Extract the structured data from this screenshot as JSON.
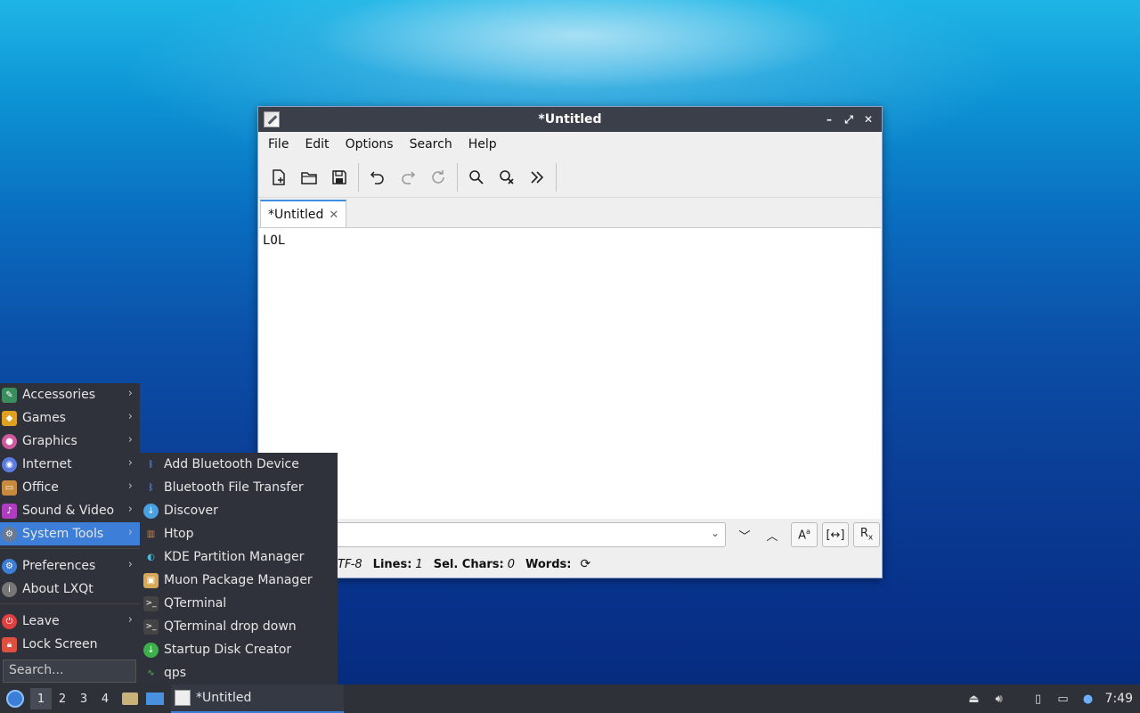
{
  "window": {
    "title": "*Untitled",
    "menus": [
      "File",
      "Edit",
      "Options",
      "Search",
      "Help"
    ],
    "tab_label": "*Untitled",
    "content": "LOL",
    "status": {
      "encoding_value": "TF-8",
      "lines_label": "Lines:",
      "lines_value": "1",
      "sel_label": "Sel. Chars:",
      "sel_value": "0",
      "words_label": "Words:"
    }
  },
  "app_menu": {
    "items": [
      {
        "label": "Accessories",
        "icon": "accessories-icon",
        "color": "#3a8d5c"
      },
      {
        "label": "Games",
        "icon": "games-icon",
        "color": "#e0a020"
      },
      {
        "label": "Graphics",
        "icon": "graphics-icon",
        "color": "#d05aa0"
      },
      {
        "label": "Internet",
        "icon": "internet-icon",
        "color": "#5a7be0"
      },
      {
        "label": "Office",
        "icon": "office-icon",
        "color": "#c88a3c"
      },
      {
        "label": "Sound & Video",
        "icon": "sound-video-icon",
        "color": "#b03cc0"
      },
      {
        "label": "System Tools",
        "icon": "system-tools-icon",
        "color": "#6a7a90"
      }
    ],
    "preferences": "Preferences",
    "about": "About LXQt",
    "leave": "Leave",
    "lock": "Lock Screen",
    "search_placeholder": "Search..."
  },
  "submenu": {
    "items": [
      {
        "label": "Add Bluetooth Device",
        "icon": "bluetooth-icon"
      },
      {
        "label": "Bluetooth File Transfer",
        "icon": "bluetooth-icon"
      },
      {
        "label": "Discover",
        "icon": "discover-icon"
      },
      {
        "label": "Htop",
        "icon": "htop-icon"
      },
      {
        "label": "KDE Partition Manager",
        "icon": "partition-manager-icon"
      },
      {
        "label": "Muon Package Manager",
        "icon": "muon-icon"
      },
      {
        "label": "QTerminal",
        "icon": "terminal-icon"
      },
      {
        "label": "QTerminal drop down",
        "icon": "terminal-icon"
      },
      {
        "label": "Startup Disk Creator",
        "icon": "startup-disk-icon"
      },
      {
        "label": "qps",
        "icon": "qps-icon"
      }
    ]
  },
  "taskbar": {
    "desktops": [
      "1",
      "2",
      "3",
      "4"
    ],
    "task_title": "*Untitled",
    "clock": "7:49"
  },
  "colors": {
    "accent": "#3d7fd8",
    "panel": "#2e3138",
    "menu": "#2f323a"
  }
}
